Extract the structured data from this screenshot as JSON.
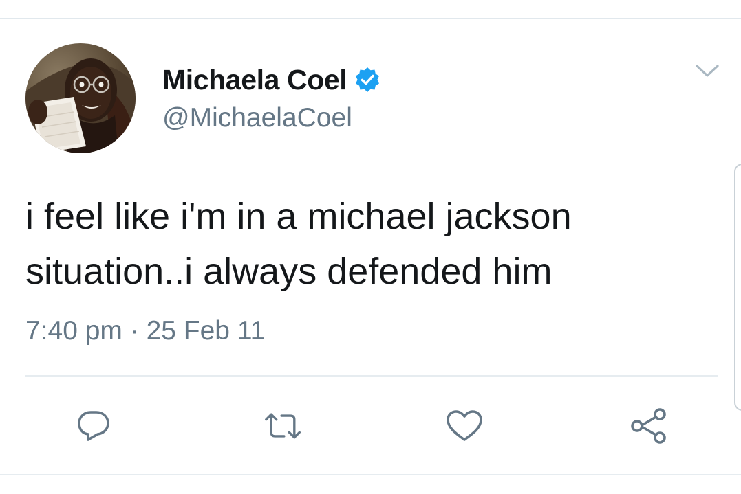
{
  "tweet": {
    "author": {
      "display_name": "Michaela Coel",
      "handle": "@MichaelaCoel",
      "verified": true
    },
    "text_lines": [
      "i feel like i'm in a michael jackson",
      "situation..i always defended him"
    ],
    "timestamp": "7:40 pm · 25 Feb 11"
  },
  "icons": {
    "menu": "chevron-down-icon",
    "verified": "verified-badge-icon",
    "reply": "reply-icon",
    "retweet": "retweet-icon",
    "like": "heart-icon",
    "share": "share-icon"
  },
  "colors": {
    "text_primary": "#14171a",
    "text_secondary": "#657786",
    "verified_blue": "#1da1f2",
    "icon_gray": "#657786",
    "divider": "#e6ecf0"
  }
}
